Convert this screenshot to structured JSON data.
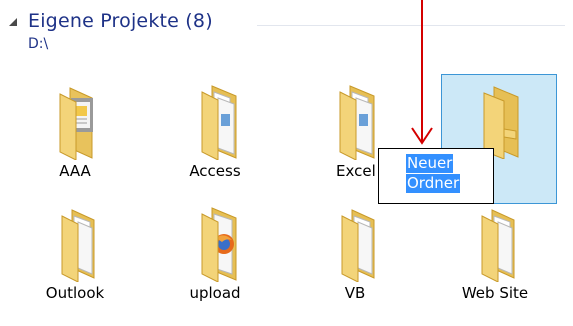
{
  "group": {
    "title": "Eigene Projekte (8)",
    "path": "D:\\"
  },
  "items": [
    {
      "label": "AAA",
      "icon": "folder-document-icon"
    },
    {
      "label": "Access",
      "icon": "folder-files-icon"
    },
    {
      "label": "Excel",
      "icon": "folder-files-icon"
    },
    {
      "label": "",
      "icon": "folder-icon",
      "state": "selected-renaming"
    },
    {
      "label": "Outlook",
      "icon": "folder-files-icon"
    },
    {
      "label": "upload",
      "icon": "folder-firefox-icon"
    },
    {
      "label": "VB",
      "icon": "folder-files-icon"
    },
    {
      "label": "Web Site",
      "icon": "folder-files-icon"
    }
  ],
  "rename": {
    "line1": "Neuer",
    "line2": "Ordner"
  },
  "colors": {
    "header_text": "#1e3287",
    "selection_fill": "#cce8f7",
    "selection_border": "#3c96d6",
    "text_highlight": "#3390ff",
    "annotation_arrow": "#d40000"
  }
}
